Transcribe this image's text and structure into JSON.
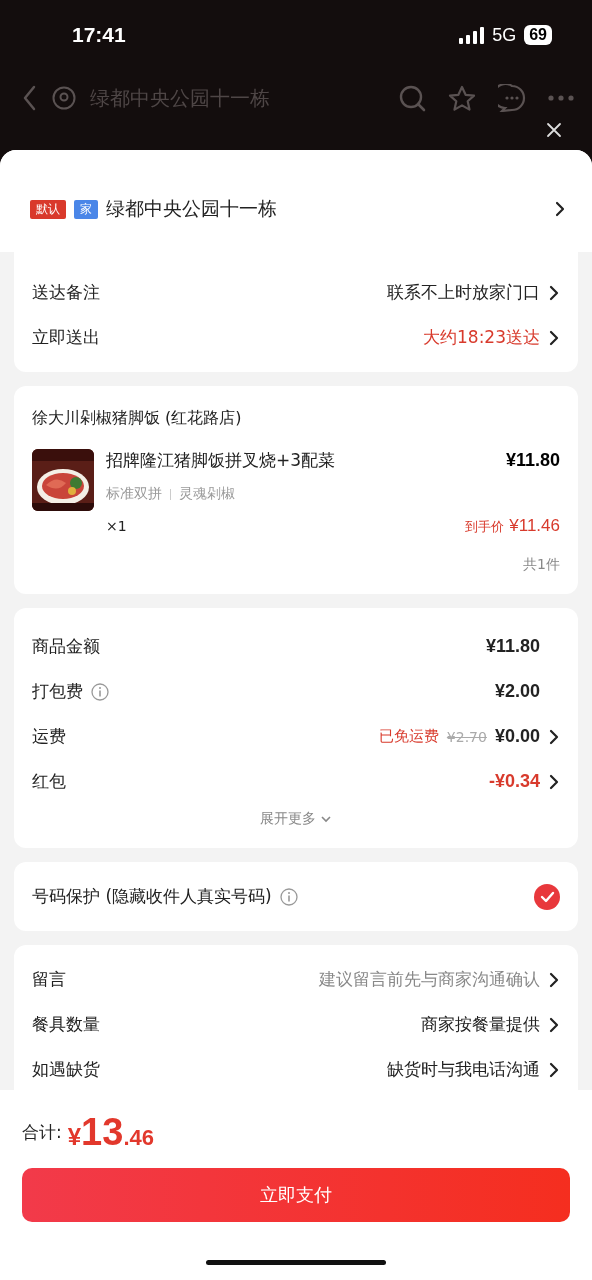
{
  "status_bar": {
    "time": "17:41",
    "network": "5G",
    "battery": "69"
  },
  "nav": {
    "address": "绿都中央公园十一栋"
  },
  "address_card": {
    "tags": [
      {
        "label": "默认",
        "color": "#d9392b"
      },
      {
        "label": "家",
        "color": "#4a86e8"
      }
    ],
    "address": "绿都中央公园十一栋",
    "rows": [
      {
        "label": "送达备注",
        "value": "联系不上时放家门口",
        "highlight": false
      },
      {
        "label": "立即送出",
        "value": "大约18:23送达",
        "highlight": true
      }
    ]
  },
  "store": {
    "name": "徐大川剁椒猪脚饭 (红花路店)",
    "item": {
      "kind": "picture",
      "title": "招牌隆江猪脚饭拼叉烧+3配菜",
      "price": "¥11.80",
      "specs": [
        "标准双拼",
        "灵魂剁椒"
      ],
      "quantity": "×1",
      "final_label": "到手价",
      "final_price": "¥11.46"
    },
    "count": "共1件"
  },
  "fees": {
    "rows": [
      {
        "label": "商品金额",
        "value": "¥11.80",
        "info": false,
        "arrow": false,
        "highlight": false
      },
      {
        "label": "打包费",
        "value": "¥2.00",
        "info": true,
        "arrow": false,
        "highlight": false
      },
      {
        "label": "运费",
        "note": "已免运费",
        "original": "¥2.70",
        "value": "¥0.00",
        "info": false,
        "arrow": true,
        "highlight": false
      },
      {
        "label": "红包",
        "value": "-¥0.34",
        "info": false,
        "arrow": true,
        "highlight": true
      }
    ],
    "expand": "展开更多"
  },
  "privacy": {
    "label": "号码保护 (隐藏收件人真实号码)",
    "checked": true
  },
  "options": [
    {
      "label": "留言",
      "value": "建议留言前先与商家沟通确认",
      "muted": true
    },
    {
      "label": "餐具数量",
      "value": "商家按餐量提供",
      "muted": false
    },
    {
      "label": "如遇缺货",
      "value": "缺货时与我电话沟通",
      "muted": false
    }
  ],
  "footer": {
    "total_label": "合计:",
    "currency": "¥",
    "total_int": "13",
    "total_dec": ".46",
    "pay_button": "立即支付"
  }
}
